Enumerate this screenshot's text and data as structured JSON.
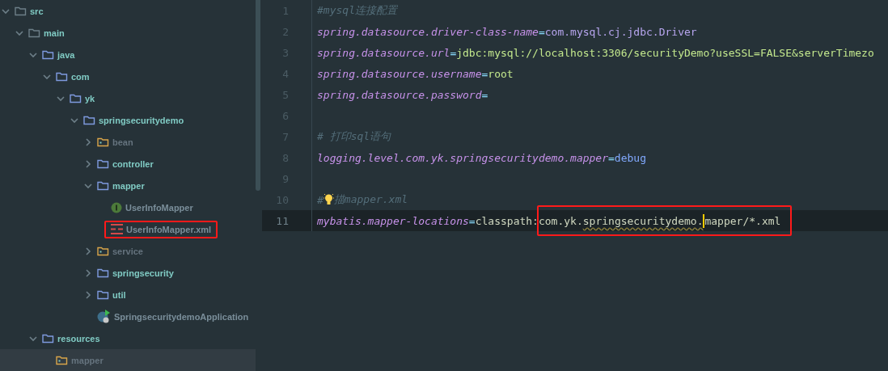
{
  "project_tree": {
    "items": [
      {
        "name": "src",
        "kind": "folder",
        "expanded": true,
        "selected": false,
        "marked": false,
        "children": [
          {
            "name": "main",
            "kind": "folder",
            "expanded": true,
            "selected": false,
            "marked": false,
            "children": [
              {
                "name": "java",
                "kind": "source-folder",
                "expanded": true,
                "selected": false,
                "marked": false,
                "children": [
                  {
                    "name": "com",
                    "kind": "source-folder",
                    "expanded": true,
                    "selected": false,
                    "marked": false,
                    "children": [
                      {
                        "name": "yk",
                        "kind": "source-folder",
                        "expanded": true,
                        "selected": false,
                        "marked": false,
                        "children": [
                          {
                            "name": "springsecuritydemo",
                            "kind": "source-folder",
                            "expanded": true,
                            "selected": false,
                            "marked": false,
                            "children": [
                              {
                                "name": "bean",
                                "kind": "package-folder",
                                "expanded": false,
                                "selected": false,
                                "marked": false
                              },
                              {
                                "name": "controller",
                                "kind": "source-folder",
                                "expanded": false,
                                "selected": false,
                                "marked": false
                              },
                              {
                                "name": "mapper",
                                "kind": "source-folder",
                                "expanded": true,
                                "selected": false,
                                "marked": false,
                                "children": [
                                  {
                                    "name": "UserInfoMapper",
                                    "kind": "interface",
                                    "selected": false,
                                    "marked": false
                                  },
                                  {
                                    "name": "UserInfoMapper.xml",
                                    "kind": "xml",
                                    "selected": false,
                                    "marked": true
                                  }
                                ]
                              },
                              {
                                "name": "service",
                                "kind": "package-folder",
                                "expanded": false,
                                "selected": false,
                                "marked": false
                              },
                              {
                                "name": "springsecurity",
                                "kind": "source-folder",
                                "expanded": false,
                                "selected": false,
                                "marked": false
                              },
                              {
                                "name": "util",
                                "kind": "source-folder",
                                "expanded": false,
                                "selected": false,
                                "marked": false
                              },
                              {
                                "name": "SpringsecuritydemoApplication",
                                "kind": "spring-class",
                                "selected": false,
                                "marked": false
                              }
                            ]
                          }
                        ]
                      }
                    ]
                  }
                ]
              },
              {
                "name": "resources",
                "kind": "source-folder",
                "expanded": true,
                "selected": false,
                "marked": false,
                "children": [
                  {
                    "name": "mapper",
                    "kind": "package-folder",
                    "selected": true,
                    "marked": false
                  }
                ]
              }
            ]
          }
        ]
      }
    ]
  },
  "editor": {
    "lines": [
      {
        "number": "1",
        "current": false,
        "tokens": [
          {
            "kind": "comment",
            "text": "#mysql连接配置"
          }
        ]
      },
      {
        "number": "2",
        "current": false,
        "tokens": [
          {
            "kind": "key",
            "text": "spring.datasource.driver-class-name"
          },
          {
            "kind": "op",
            "text": "="
          },
          {
            "kind": "class-value",
            "text": "com.mysql.cj.jdbc.Driver"
          }
        ]
      },
      {
        "number": "3",
        "current": false,
        "tokens": [
          {
            "kind": "key",
            "text": "spring.datasource.url"
          },
          {
            "kind": "op",
            "text": "="
          },
          {
            "kind": "value",
            "text": "jdbc:mysql://localhost:3306/securityDemo?useSSL=FALSE&serverTimezo"
          }
        ]
      },
      {
        "number": "4",
        "current": false,
        "tokens": [
          {
            "kind": "key",
            "text": "spring.datasource.username"
          },
          {
            "kind": "op",
            "text": "="
          },
          {
            "kind": "value",
            "text": "root"
          }
        ]
      },
      {
        "number": "5",
        "current": false,
        "tokens": [
          {
            "kind": "key",
            "text": "spring.datasource.password"
          },
          {
            "kind": "op",
            "text": "="
          }
        ]
      },
      {
        "number": "6",
        "current": false
      },
      {
        "number": "7",
        "current": false,
        "tokens": [
          {
            "kind": "comment",
            "text": "# 打印sql语句"
          }
        ]
      },
      {
        "number": "8",
        "current": false,
        "tokens": [
          {
            "kind": "key",
            "text": "logging.level.com.yk.springsecuritydemo.mapper"
          },
          {
            "kind": "op",
            "text": "="
          },
          {
            "kind": "enum-value",
            "text": "debug"
          }
        ]
      },
      {
        "number": "9",
        "current": false
      },
      {
        "number": "10",
        "current": false,
        "tokens": [
          {
            "kind": "comment",
            "text": "#"
          },
          {
            "kind": "bulb"
          },
          {
            "kind": "comment",
            "text": "描mapper.xml"
          }
        ]
      },
      {
        "number": "11",
        "current": true,
        "tokens": [
          {
            "kind": "key",
            "text": "mybatis.mapper-locations"
          },
          {
            "kind": "op",
            "text": "="
          },
          {
            "kind": "path",
            "text": "classpath:"
          }
        ],
        "marked_tokens": [
          {
            "kind": "path",
            "text": "com.yk.",
            "caret_after": false
          },
          {
            "kind": "warning-path",
            "text": "springsecuritydemo.",
            "caret_after": true
          },
          {
            "kind": "path",
            "text": "mapper/*.xml",
            "caret_after": false
          }
        ]
      }
    ]
  }
}
